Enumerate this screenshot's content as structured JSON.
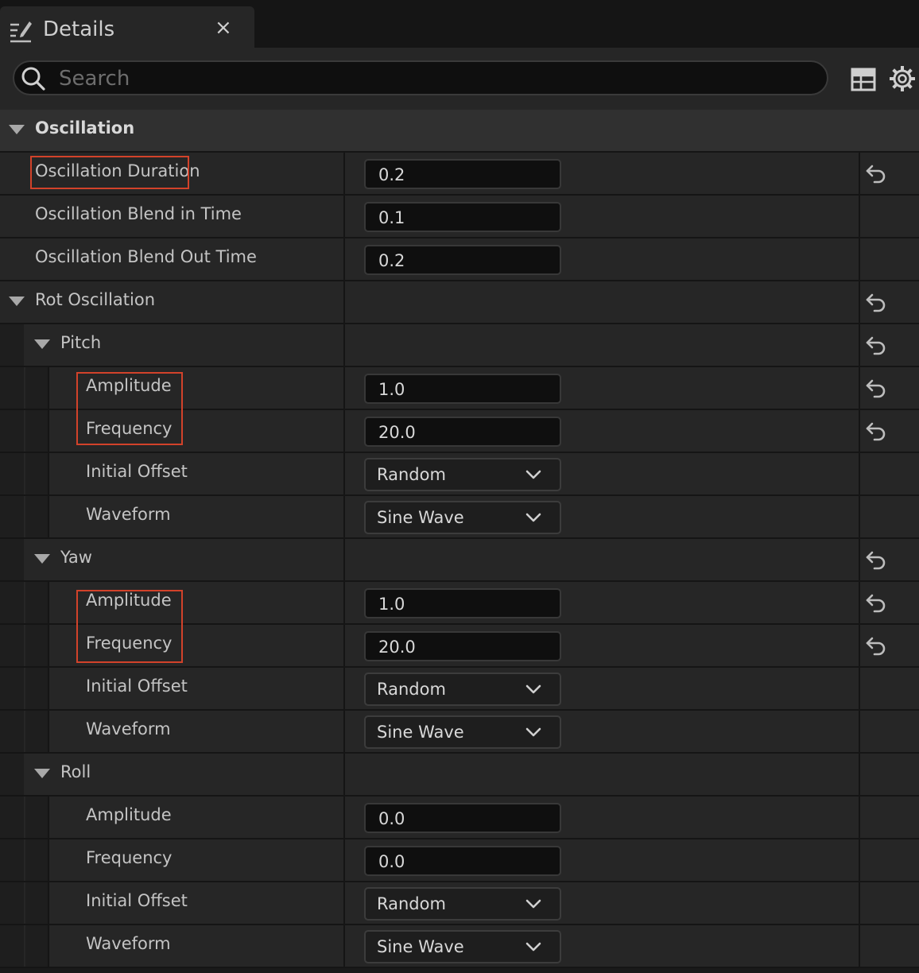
{
  "tab": {
    "title": "Details",
    "close": "×"
  },
  "search": {
    "placeholder": "Search",
    "value": ""
  },
  "icons": {
    "tab": "pencil-details-icon",
    "search": "search-icon",
    "table": "table-view-icon",
    "settings": "gear-icon",
    "reset": "reset-arrow-icon",
    "expand": "triangle-down-icon",
    "dropdown": "chevron-down-icon"
  },
  "colors": {
    "highlight": "#d2422a",
    "background": "#262626",
    "input": "#0f0f0f"
  },
  "category": {
    "label": "Oscillation"
  },
  "oscillation": {
    "duration": {
      "label": "Oscillation Duration",
      "value": "0.2"
    },
    "blend_in": {
      "label": "Oscillation Blend in Time",
      "value": "0.1"
    },
    "blend_out": {
      "label": "Oscillation Blend Out Time",
      "value": "0.2"
    }
  },
  "rot": {
    "label": "Rot Oscillation",
    "pitch": {
      "label": "Pitch",
      "amplitude": {
        "label": "Amplitude",
        "value": "1.0"
      },
      "frequency": {
        "label": "Frequency",
        "value": "20.0"
      },
      "initial_offset": {
        "label": "Initial Offset",
        "value": "Random"
      },
      "waveform": {
        "label": "Waveform",
        "value": "Sine Wave"
      }
    },
    "yaw": {
      "label": "Yaw",
      "amplitude": {
        "label": "Amplitude",
        "value": "1.0"
      },
      "frequency": {
        "label": "Frequency",
        "value": "20.0"
      },
      "initial_offset": {
        "label": "Initial Offset",
        "value": "Random"
      },
      "waveform": {
        "label": "Waveform",
        "value": "Sine Wave"
      }
    },
    "roll": {
      "label": "Roll",
      "amplitude": {
        "label": "Amplitude",
        "value": "0.0"
      },
      "frequency": {
        "label": "Frequency",
        "value": "0.0"
      },
      "initial_offset": {
        "label": "Initial Offset",
        "value": "Random"
      },
      "waveform": {
        "label": "Waveform",
        "value": "Sine Wave"
      }
    }
  }
}
